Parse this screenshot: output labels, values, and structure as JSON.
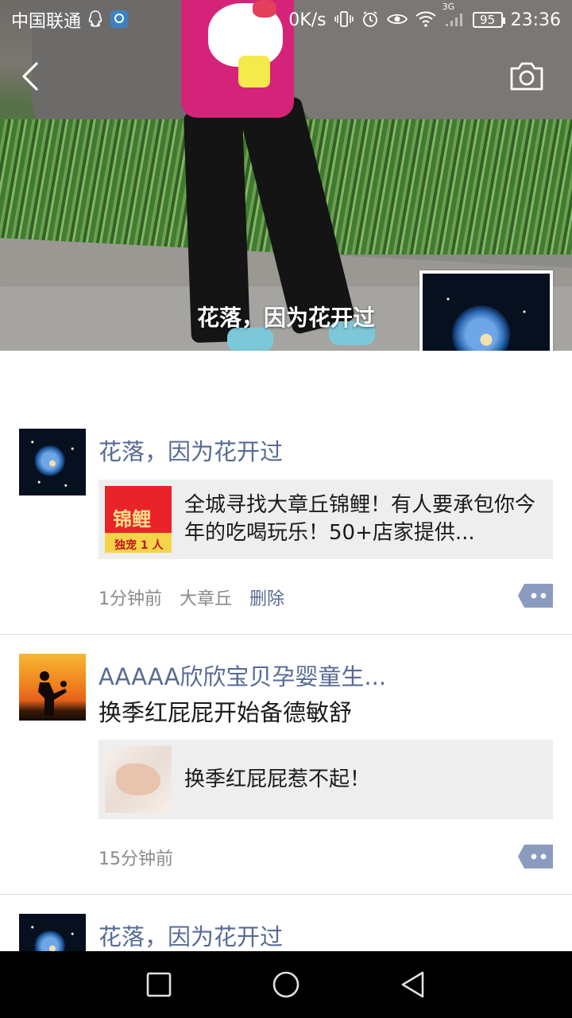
{
  "status_bar": {
    "carrier": "中国联通",
    "net_speed": "0K/s",
    "network": "3G",
    "battery": "95",
    "time": "23:36",
    "icons": [
      "qq-icon",
      "app-notification-icon",
      "vibrate-icon",
      "alarm-icon",
      "eye-icon",
      "wifi-icon",
      "signal-icon",
      "battery-icon"
    ]
  },
  "header": {
    "profile_name": "花落，因为花开过",
    "back_icon": "chevron-left-icon",
    "camera_icon": "camera-icon"
  },
  "posts": [
    {
      "author": "花落，因为花开过",
      "link_title": "全城寻找大章丘锦鲤！有人要承包你今年的吃喝玩乐！50+店家提供...",
      "thumb_text": "锦鲤",
      "thumb_sub": "独宠 1 人",
      "time": "1分钟前",
      "location": "大章丘",
      "delete_label": "删除"
    },
    {
      "author": "AAAAA欣欣宝贝孕婴童生...",
      "text": "换季红屁屁开始备德敏舒",
      "link_title": "换季红屁屁惹不起！",
      "time": "15分钟前"
    },
    {
      "author": "花落，因为花开过"
    }
  ],
  "nav": {
    "icons": [
      "recent-apps-icon",
      "home-icon",
      "back-icon"
    ]
  },
  "colors": {
    "link_name": "#576b95",
    "card_bg": "#eeeeee",
    "meta_text": "#8a8a8a"
  }
}
